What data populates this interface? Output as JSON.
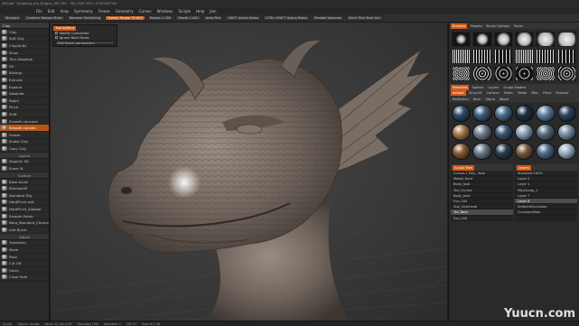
{
  "titlebar": {
    "app": "3DCoat",
    "file": "Sculpting_the_Dragon_007.3b* - 3D-COAT 2021.15 BOOST 64"
  },
  "menu": [
    "File",
    "Edit",
    "View",
    "Symmetry",
    "Freeze",
    "Geometry",
    "Curves",
    "Windows",
    "Scripts",
    "Help",
    "Join"
  ],
  "toolbar": {
    "items": [
      "Sharpen",
      "Conform Retopo Mesh",
      "Remove Stretching",
      "Steady Stroke 70.000",
      "Radius 1.000",
      "Depth 1.000",
      "Auto Pick",
      "SHIFT Action Relax",
      "CTRL+SHIFT Action Relax",
      "Shaded Volumes",
      "Don't Pick Start Act."
    ],
    "active_index": 3
  },
  "left_panel": {
    "header": "Clay",
    "brushes": [
      "Clay",
      "Soft Clay",
      "Clay(bulk)",
      "Draw",
      "Trim Adaptive",
      "Fill",
      "Buildup",
      "Extrude",
      "Expand",
      "Absolute",
      "Rapid",
      "Pinch",
      "Shift",
      "Smooth concave",
      "Smooth convex",
      "Freeze",
      "Snake Clay",
      "Copy Clay"
    ],
    "selected_brush_index": 14,
    "section_layers": "Layers",
    "layer_items": [
      "Magnify 3D",
      "Erase 3L"
    ],
    "section_custom": "Custom",
    "custom_brushes": [
      "Base brush",
      "StitchesHP",
      "Standard Dig",
      "HardPinch soft",
      "HardPinch_Aldebar",
      "Smooth Polish",
      "Nora_Standard_Chrona",
      "Anti Brush"
    ],
    "section_adjust": "Adjust",
    "adjust_items": [
      "Transform",
      "Move",
      "Pose",
      "Cut Off",
      "Holes",
      "Close Hole"
    ]
  },
  "floating_panel": {
    "tab": "Tool options",
    "options": [
      "Modify Connected",
      "Ignore Back Faces"
    ],
    "button": "Edit Brush parameters"
  },
  "right_panel": {
    "brush_tabs": [
      "Brushes",
      "Presets",
      "Brush Options",
      "Panel"
    ],
    "brush_tab_active": 0,
    "mat_tabs": [
      "Materials",
      "Splines",
      "Layers",
      "Sculpt Models"
    ],
    "mat_tab_active": 0,
    "mat_subtabs": [
      "default",
      "3D-print",
      "Cartoon",
      "Fabric",
      "Metal",
      "Misc",
      "Plant",
      "Polymer",
      "Reflection",
      "Rock",
      "Stone",
      "Wood"
    ],
    "materials": [
      "#2c4b6a",
      "#3d5c7a",
      "#4a6e8a",
      "#1e2e45",
      "#5d7f9e",
      "#2b4360",
      "#a57a4a",
      "#6f8090",
      "#3a5470",
      "#8aa3bb",
      "#596c80",
      "#7890a8",
      "#8a5a30",
      "#6b7a8a",
      "#2a3c52",
      "#7a5a3a",
      "#4e6a88",
      "#9bb0c4"
    ],
    "scene_tab": "Sculpt Tree",
    "scene_tree": [
      "Curves 1 Poly, Hide",
      "Model_front",
      "Body_bulk",
      "Tail_Curved",
      "Body_bulk",
      "Eye_000",
      "Sub_Gearhead",
      "Tail_Boot",
      "Eye_000"
    ],
    "scene_selected": 7,
    "layer_tab": "Layers",
    "layers_list": [
      "Layer 0",
      "Layer 1",
      "PolyGroup_1",
      "Layer 7",
      "Layer 8",
      "AmbientOcclusion",
      "CurvatureMap"
    ],
    "layer_selected": 4,
    "blend_label": "Standard",
    "opacity_label": "100%"
  },
  "status": {
    "items": [
      "Sculpt",
      "Object: Sculpt",
      "Faces 12,345,678",
      "Triangles 15M",
      "Selection 0",
      "FPS 57",
      "Ram 8.2 GB"
    ]
  },
  "watermark": "Yuucn.com"
}
